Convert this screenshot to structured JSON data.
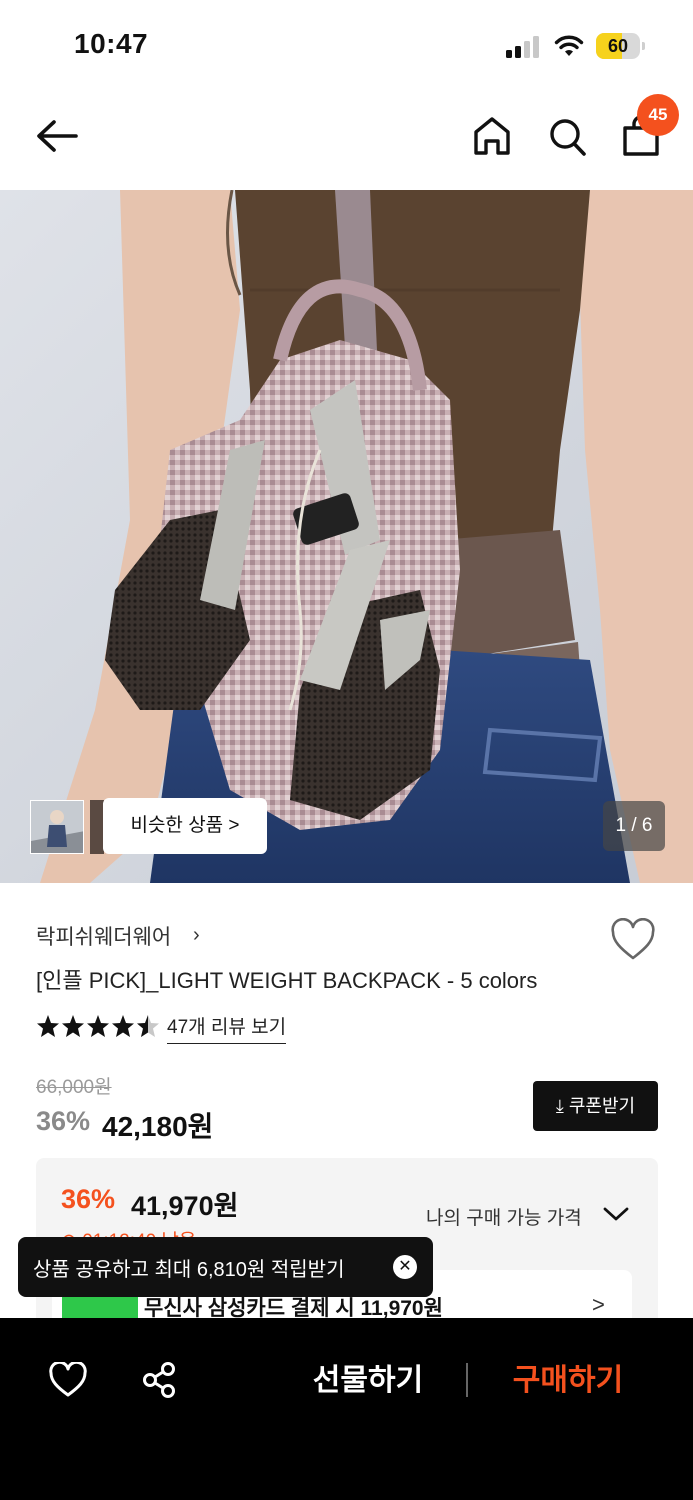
{
  "status_bar": {
    "time": "10:47",
    "battery_level": "60"
  },
  "header": {
    "cart_count": "45"
  },
  "gallery": {
    "similar_label": "비슷한 상품 >",
    "page_indicator": "1 / 6"
  },
  "product": {
    "brand": "락피쉬웨더웨어",
    "brand_chevron": "›",
    "title": "[인플 PICK]_LIGHT WEIGHT BACKPACK - 5 colors",
    "rating_stars": 4.5,
    "review_link": "47개 리뷰 보기",
    "original_price": "66,000원",
    "discount_pct": "36%",
    "sale_price": "42,180원",
    "coupon_button": "⤓ 쿠폰받기"
  },
  "best_price": {
    "discount_pct": "36%",
    "price": "41,970원",
    "my_price_label": "나의 구매 가능 가격",
    "timer": "⊙ 01:12:40 남음",
    "card_text": "무신사 삼성카드 결제 시 11,970원",
    "card_chevron": ">"
  },
  "toast": {
    "text": "상품 공유하고 최대 6,810원 적립받기",
    "close": "✕"
  },
  "bottom_bar": {
    "gift_label": "선물하기",
    "buy_label": "구매하기"
  },
  "colors": {
    "accent": "#f4511e",
    "black": "#000000"
  },
  "icons": [
    "back-arrow-icon",
    "home-icon",
    "search-icon",
    "cart-icon",
    "heart-icon",
    "share-icon",
    "star-icon",
    "download-icon",
    "chevron-down-icon",
    "close-icon"
  ]
}
